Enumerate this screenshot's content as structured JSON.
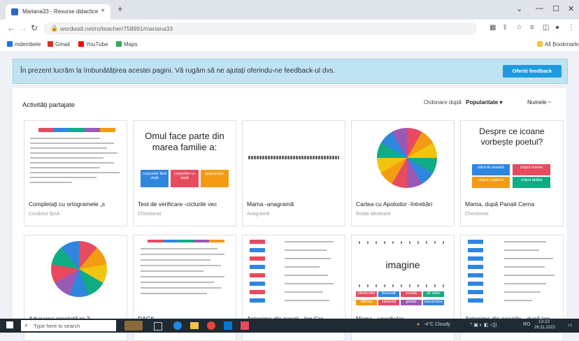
{
  "browser": {
    "tab_title": "Mariana33 - Resurse didactice",
    "tab_close": "×",
    "new_tab": "+",
    "url": "wordwall.net/ro/teacher/758991/mariana33",
    "bookmarks": [
      {
        "label": "mdembele",
        "color": "#1a73e8"
      },
      {
        "label": "Gmail",
        "color": "#d93025"
      },
      {
        "label": "YouTube",
        "color": "#ff0000"
      },
      {
        "label": "Maps",
        "color": "#34a853"
      }
    ],
    "all_bookmarks": "All Bookmarks"
  },
  "banner": {
    "message": "În prezent lucrăm la îmbunătățirea acestei pagini. Vă rugăm să ne ajutați oferindu-ne feedback-ul dvs.",
    "button": "Oferiti feedback"
  },
  "panel": {
    "title": "Activități partajate",
    "sort_label": "Ordonare după",
    "sort_selected": "Popularitate ▾",
    "sort_other": "Numele ~"
  },
  "cards": [
    {
      "title": "Completați cu ortogramele „s",
      "subtitle": "Cuvântul lipsă"
    },
    {
      "title": "Test de verificare -ciclurile vec",
      "subtitle": "Chestionar",
      "thumb_text": "Omul face parte din marea familie a:",
      "tiles": [
        "corpurilor fără viață",
        "corpurilor cu viață",
        "popoarelor"
      ]
    },
    {
      "title": "Mama -anagramă",
      "subtitle": "Anagramă"
    },
    {
      "title": "Cartea cu Apolodor -întrebări",
      "subtitle": "Roata aleatoare"
    },
    {
      "title": "Mama, după Panait Cerna",
      "subtitle": "Chestionar",
      "thumb_text": "Despre ce icoane vorbește poetul?",
      "tiles": [
        "sfânt Ai noastră",
        "chipul mamei",
        "chipul copilului",
        "chipul tatălui"
      ]
    },
    {
      "title": "Adunarea repetată nr 2",
      "subtitle": ""
    },
    {
      "title": "DAGIL",
      "subtitle": ""
    },
    {
      "title": "Antonime din poezii - Ion Cre",
      "subtitle": ""
    },
    {
      "title": "Mama - vocabular",
      "subtitle": "",
      "thumb_text": "imagine",
      "tiles": [
        "cântecelul",
        "buzunat",
        "vesela",
        "de aduc",
        "efluvial",
        "zaharisit",
        "grasie",
        "bucuroasa"
      ]
    },
    {
      "title": "Antonime din poeziile - după Ion",
      "subtitle": ""
    }
  ],
  "taskbar": {
    "search_placeholder": "Type here to search",
    "weather": "-4°C Cloudy",
    "lang": "RO",
    "time": "13:22",
    "date": "26.11.2023"
  }
}
